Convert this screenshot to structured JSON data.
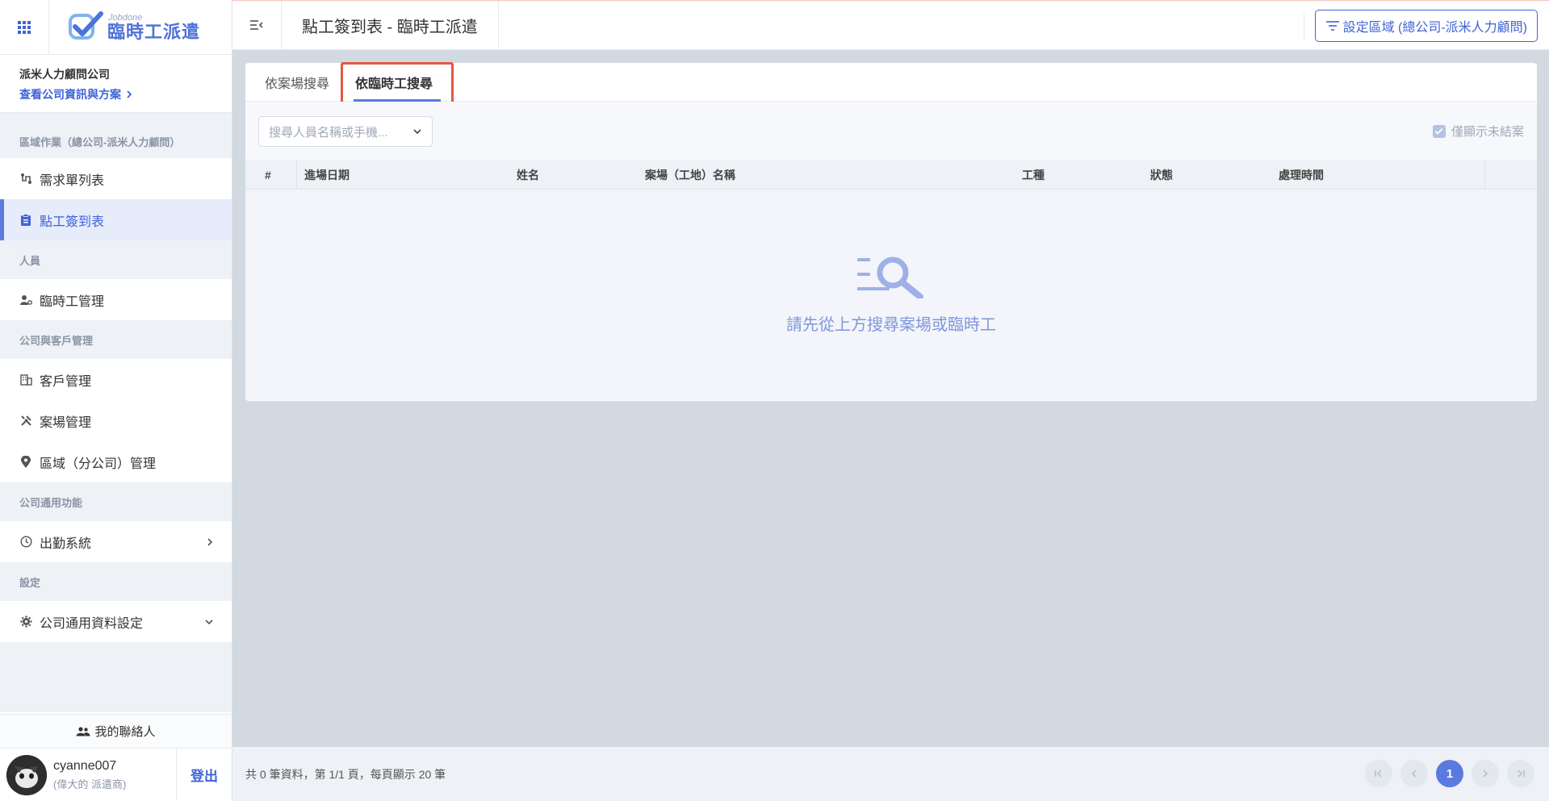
{
  "app": {
    "logo_small": "Jobdone",
    "logo_title": "臨時工派遣"
  },
  "company": {
    "name": "派米人力顧問公司",
    "link_label": "查看公司資訊與方案"
  },
  "sidebar": {
    "sections": [
      {
        "title": "區域作業（總公司-派米人力顧問）",
        "items": [
          {
            "label": "需求單列表",
            "icon": "route-icon",
            "active": false
          },
          {
            "label": "點工簽到表",
            "icon": "clipboard-icon",
            "active": true
          }
        ]
      },
      {
        "title": "人員",
        "items": [
          {
            "label": "臨時工管理",
            "icon": "user-gear-icon",
            "active": false
          }
        ]
      },
      {
        "title": "公司與客戶管理",
        "items": [
          {
            "label": "客戶管理",
            "icon": "building-icon",
            "active": false
          },
          {
            "label": "案場管理",
            "icon": "tools-icon",
            "active": false
          },
          {
            "label": "區域（分公司）管理",
            "icon": "location-pin-icon",
            "active": false
          }
        ]
      },
      {
        "title": "公司通用功能",
        "items": [
          {
            "label": "出勤系統",
            "icon": "clock-icon",
            "active": false
          }
        ]
      },
      {
        "title": "設定",
        "items": [
          {
            "label": "公司通用資料設定",
            "icon": "gear-icon",
            "active": false
          }
        ]
      }
    ],
    "contacts_label": "我的聯絡人",
    "user": {
      "name": "cyanne007",
      "role": "(偉大的 派遣商)"
    },
    "logout_label": "登出"
  },
  "header": {
    "title": "點工簽到表 - 臨時工派遣",
    "region_button": "設定區域 (總公司-派米人力顧問)"
  },
  "tabs": [
    {
      "label": "依案場搜尋",
      "active": false
    },
    {
      "label": "依臨時工搜尋",
      "active": true
    }
  ],
  "search": {
    "placeholder": "搜尋人員名稱或手機..."
  },
  "filter": {
    "only_unfinished_label": "僅顯示未結案",
    "checked": true
  },
  "table": {
    "columns": [
      "#",
      "進場日期",
      "姓名",
      "案場（工地）名稱",
      "工種",
      "狀態",
      "處理時間"
    ]
  },
  "empty_state": {
    "message": "請先從上方搜尋案場或臨時工"
  },
  "footer": {
    "summary": "共 0 筆資料，第 1/1 頁，每頁顯示 20 筆",
    "current_page": "1"
  },
  "colors": {
    "accent": "#3f63d6",
    "highlight_box": "#e05a42"
  }
}
